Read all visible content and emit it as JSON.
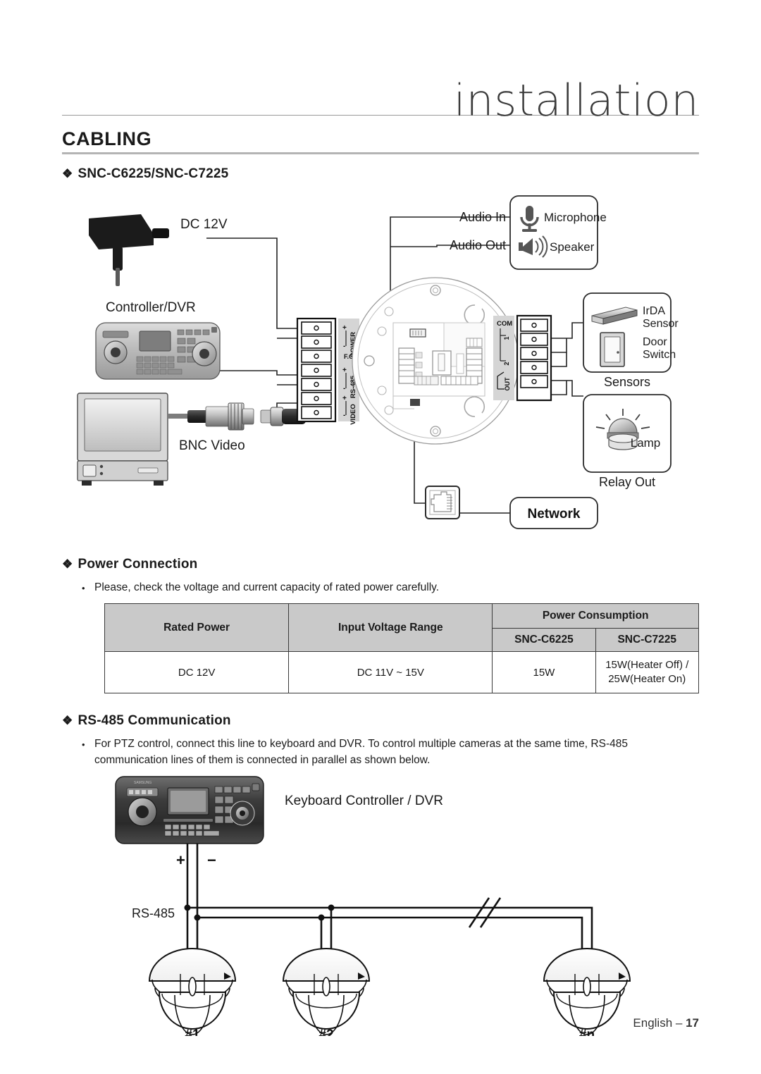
{
  "header": {
    "chapter_title": "installation",
    "section_title": "CABLING"
  },
  "models_heading": {
    "bullet": "❖",
    "label": "SNC-C6225/SNC-C7225"
  },
  "cabling_diagram": {
    "power_source_label": "DC 12V",
    "controller_label": "Controller/DVR",
    "bnc_label": "BNC Video",
    "audio_in_label": "Audio In",
    "audio_out_label": "Audio Out",
    "microphone_label": "Microphone",
    "speaker_label": "Speaker",
    "irda_label_line1": "IrDA",
    "irda_label_line2": "Sensor",
    "door_label_line1": "Door",
    "door_label_line2": "Switch",
    "sensors_label": "Sensors",
    "lamp_label": "Lamp",
    "relay_out_label": "Relay Out",
    "network_label": "Network",
    "terminal_block_left": [
      {
        "sign": "+",
        "group": "POWER"
      },
      {
        "sign": "-",
        "group": "POWER"
      },
      {
        "sign": "",
        "group": "F.G"
      },
      {
        "sign": "+",
        "group": "RS-485"
      },
      {
        "sign": "-",
        "group": "RS-485"
      },
      {
        "sign": "+",
        "group": "VIDEO"
      },
      {
        "sign": "-",
        "group": "VIDEO"
      }
    ],
    "terminal_group_labels_left": [
      "POWER",
      "F.G",
      "RS-485",
      "VIDEO"
    ],
    "terminal_block_right_labels": [
      "COM",
      "1",
      "2",
      "OUT"
    ]
  },
  "power_connection": {
    "bullet": "❖",
    "heading": "Power Connection",
    "note_bullet": "•",
    "note": "Please, check the voltage and current capacity of rated power carefully."
  },
  "power_table": {
    "headers": {
      "rated_power": "Rated Power",
      "input_voltage_range": "Input Voltage Range",
      "power_consumption": "Power Consumption",
      "model_a": "SNC-C6225",
      "model_b": "SNC-C7225"
    },
    "rows": [
      {
        "rated_power": "DC 12V",
        "input_voltage_range": "DC 11V ~ 15V",
        "model_a_value": "15W",
        "model_b_line1": "15W(Heater Off) /",
        "model_b_line2": "25W(Heater On)"
      }
    ]
  },
  "rs485_section": {
    "bullet": "❖",
    "heading": "RS-485 Communication",
    "note_bullet": "•",
    "note_line1": "For PTZ control, connect this line to keyboard and DVR. To control multiple cameras at the same time, RS-485",
    "note_line2": "communication lines of them is connected in parallel as shown below."
  },
  "rs485_diagram": {
    "keyboard_label": "Keyboard Controller / DVR",
    "bus_label": "RS-485",
    "plus_sign": "+",
    "minus_sign": "−",
    "camera_labels": [
      "#1",
      "#2",
      "#n"
    ]
  },
  "footer": {
    "language": "English – ",
    "page_number": "17"
  },
  "colors": {
    "table_header_bg": "#c9c9c9",
    "rule": "#b4b4b4",
    "ink": "#1a1a1a"
  }
}
